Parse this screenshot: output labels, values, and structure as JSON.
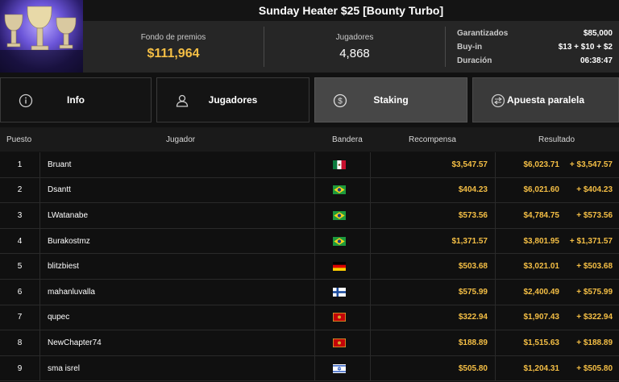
{
  "header": {
    "title": "Sunday Heater $25 [Bounty Turbo]"
  },
  "stats": {
    "prize_pool_label": "Fondo de premios",
    "prize_pool_value": "$111,964",
    "players_label": "Jugadores",
    "players_value": "4,868",
    "guaranteed_label": "Garantizados",
    "guaranteed_value": "$85,000",
    "buyin_label": "Buy-in",
    "buyin_value": "$13 + $10 + $2",
    "duration_label": "Duración",
    "duration_value": "06:38:47"
  },
  "tabs": [
    {
      "label": "Info",
      "icon": "info-icon"
    },
    {
      "label": "Jugadores",
      "icon": "user-icon"
    },
    {
      "label": "Staking",
      "icon": "dollar-coin-icon",
      "active": true
    },
    {
      "label": "Apuesta paralela",
      "icon": "parallel-bet-icon"
    }
  ],
  "table": {
    "columns": [
      "Puesto",
      "Jugador",
      "Bandera",
      "Recompensa",
      "Resultado"
    ],
    "rows": [
      {
        "pos": "1",
        "player": "Bruant",
        "flag": "mexico",
        "reward": "$3,547.57",
        "result": "$6,023.71",
        "delta": "+ $3,547.57"
      },
      {
        "pos": "2",
        "player": "Dsantt",
        "flag": "brazil",
        "reward": "$404.23",
        "result": "$6,021.60",
        "delta": "+ $404.23"
      },
      {
        "pos": "3",
        "player": "LWatanabe",
        "flag": "brazil",
        "reward": "$573.56",
        "result": "$4,784.75",
        "delta": "+ $573.56"
      },
      {
        "pos": "4",
        "player": "Burakostmz",
        "flag": "brazil",
        "reward": "$1,371.57",
        "result": "$3,801.95",
        "delta": "+ $1,371.57"
      },
      {
        "pos": "5",
        "player": "blitzbiest",
        "flag": "germany",
        "reward": "$503.68",
        "result": "$3,021.01",
        "delta": "+ $503.68"
      },
      {
        "pos": "6",
        "player": "mahanluvalla",
        "flag": "finland",
        "reward": "$575.99",
        "result": "$2,400.49",
        "delta": "+ $575.99"
      },
      {
        "pos": "7",
        "player": "qupec",
        "flag": "montenegro",
        "reward": "$322.94",
        "result": "$1,907.43",
        "delta": "+ $322.94"
      },
      {
        "pos": "8",
        "player": "NewChapter74",
        "flag": "montenegro",
        "reward": "$188.89",
        "result": "$1,515.63",
        "delta": "+ $188.89"
      },
      {
        "pos": "9",
        "player": "sma isrel",
        "flag": "israel",
        "reward": "$505.80",
        "result": "$1,204.31",
        "delta": "+ $505.80"
      }
    ]
  },
  "colors": {
    "accent_gold": "#f5bf45",
    "active_tab": "#474747"
  }
}
